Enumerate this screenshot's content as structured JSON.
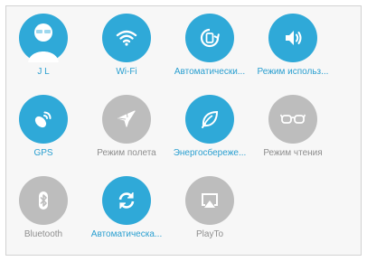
{
  "colors": {
    "active": "#2fa9d8",
    "inactive": "#bdbdbd",
    "active_label": "#2a9fd0",
    "inactive_label": "#8e8e8e"
  },
  "tiles": [
    {
      "label": "J L",
      "icon": "user-avatar-icon",
      "active": true
    },
    {
      "label": "Wi-Fi",
      "icon": "wifi-icon",
      "active": true
    },
    {
      "label": "Автоматически...",
      "icon": "auto-rotate-icon",
      "active": true
    },
    {
      "label": "Режим использ...",
      "icon": "sound-icon",
      "active": true
    },
    {
      "label": "GPS",
      "icon": "gps-icon",
      "active": true
    },
    {
      "label": "Режим полета",
      "icon": "airplane-icon",
      "active": false
    },
    {
      "label": "Энергосбереже...",
      "icon": "leaf-icon",
      "active": true
    },
    {
      "label": "Режим чтения",
      "icon": "glasses-icon",
      "active": false
    },
    {
      "label": "Bluetooth",
      "icon": "bluetooth-icon",
      "active": false
    },
    {
      "label": "Автоматическа...",
      "icon": "sync-icon",
      "active": true
    },
    {
      "label": "PlayTo",
      "icon": "playto-icon",
      "active": false
    }
  ]
}
